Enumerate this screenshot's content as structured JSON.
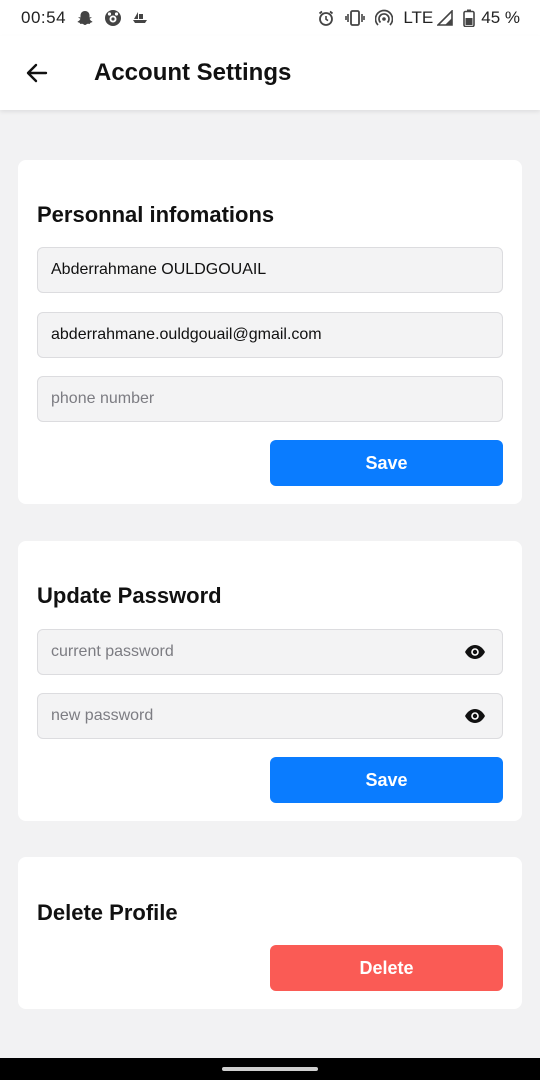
{
  "status_bar": {
    "time": "00:54",
    "network": "LTE",
    "battery": "45 %",
    "left_icons": [
      "snapchat-icon",
      "messenger-icon",
      "boat-icon"
    ],
    "right_icons": [
      "alarm-icon",
      "vibrate-icon",
      "hotspot-icon",
      "signal-icon",
      "battery-icon"
    ]
  },
  "header": {
    "title": "Account Settings",
    "back_icon": "arrow-left-icon"
  },
  "personal_info": {
    "title": "Personnal infomations",
    "name_value": "Abderrahmane OULDGOUAIL",
    "email_value": "abderrahmane.ouldgouail@gmail.com",
    "phone_placeholder": "phone number",
    "save_label": "Save"
  },
  "update_password": {
    "title": "Update Password",
    "current_placeholder": "current password",
    "new_placeholder": "new password",
    "eye_icon": "eye-icon",
    "save_label": "Save"
  },
  "delete_profile": {
    "title": "Delete Profile",
    "delete_label": "Delete"
  },
  "colors": {
    "primary": "#0a7cff",
    "danger": "#fa5b55",
    "background": "#f2f2f3"
  }
}
